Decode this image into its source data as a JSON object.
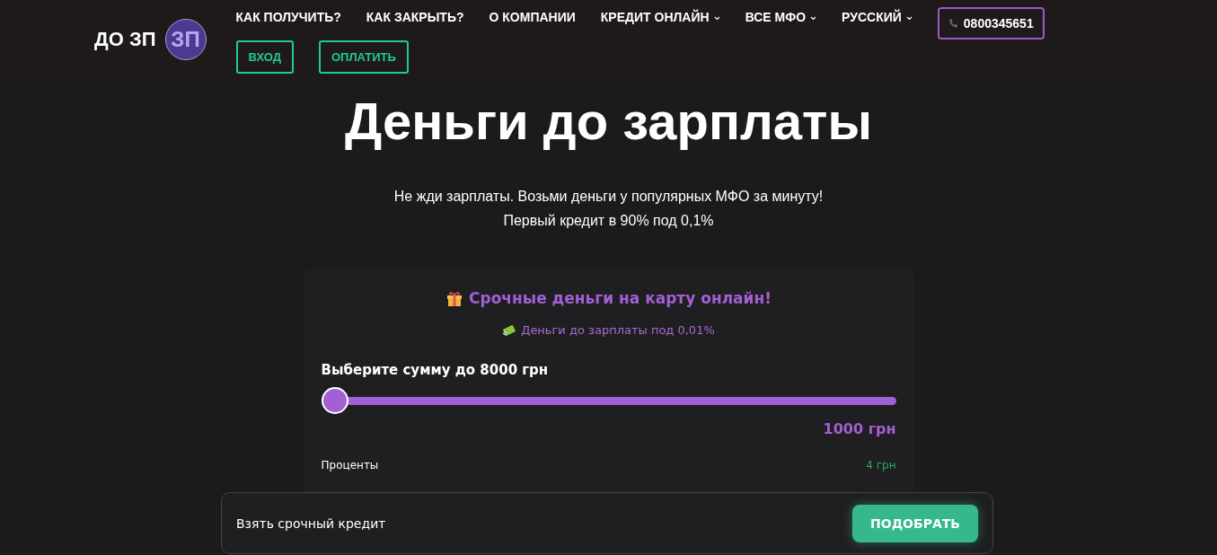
{
  "header": {
    "logo_text": "ДО ЗП",
    "logo_badge": "ЗП",
    "nav": [
      {
        "label": "КАК ПОЛУЧИТЬ?",
        "dropdown": false
      },
      {
        "label": "КАК ЗАКРЫТЬ?",
        "dropdown": false
      },
      {
        "label": "О КОМПАНИИ",
        "dropdown": false
      },
      {
        "label": "КРЕДИТ ОНЛАЙН",
        "dropdown": true
      },
      {
        "label": "ВСЕ МФО",
        "dropdown": true
      },
      {
        "label": "РУССКИЙ",
        "dropdown": true
      }
    ],
    "phone": "0800345651",
    "buttons": [
      "ВХОД",
      "ОПЛАТИТЬ"
    ]
  },
  "hero": {
    "title": "Деньги до зарплаты",
    "subtitle_lines": [
      "Не жди зарплаты. Возьми деньги у популярных МФО за минуту!",
      "Первый кредит в 90% под 0,1%"
    ]
  },
  "card": {
    "title": "Срочные деньги на карту онлайн!",
    "subtitle": "Деньги до зарплаты под 0,01%",
    "slider_label": "Выберите сумму до 8000 грн",
    "slider": {
      "level": 0
    },
    "amount": "1000 грн",
    "rows": [
      {
        "label": "Проценты",
        "value": "4 грн"
      }
    ]
  },
  "sticky_bar": {
    "text": "Взять срочный кредит",
    "button": "ПОДОБРАТЬ"
  }
}
